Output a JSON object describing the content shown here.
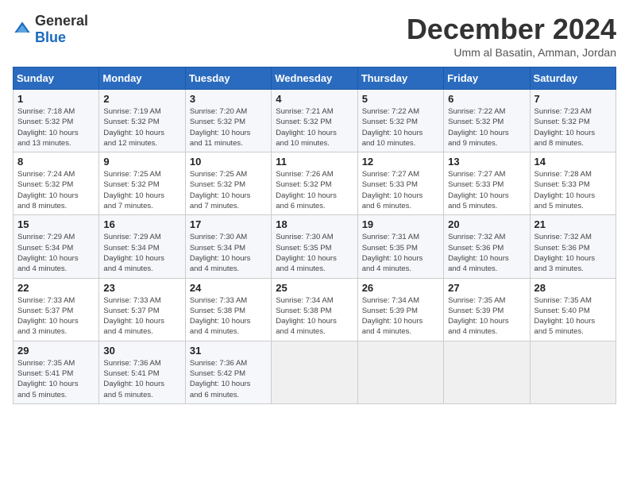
{
  "logo": {
    "general": "General",
    "blue": "Blue"
  },
  "header": {
    "month_year": "December 2024",
    "location": "Umm al Basatin, Amman, Jordan"
  },
  "weekdays": [
    "Sunday",
    "Monday",
    "Tuesday",
    "Wednesday",
    "Thursday",
    "Friday",
    "Saturday"
  ],
  "weeks": [
    [
      {
        "day": "1",
        "info": "Sunrise: 7:18 AM\nSunset: 5:32 PM\nDaylight: 10 hours\nand 13 minutes."
      },
      {
        "day": "2",
        "info": "Sunrise: 7:19 AM\nSunset: 5:32 PM\nDaylight: 10 hours\nand 12 minutes."
      },
      {
        "day": "3",
        "info": "Sunrise: 7:20 AM\nSunset: 5:32 PM\nDaylight: 10 hours\nand 11 minutes."
      },
      {
        "day": "4",
        "info": "Sunrise: 7:21 AM\nSunset: 5:32 PM\nDaylight: 10 hours\nand 10 minutes."
      },
      {
        "day": "5",
        "info": "Sunrise: 7:22 AM\nSunset: 5:32 PM\nDaylight: 10 hours\nand 10 minutes."
      },
      {
        "day": "6",
        "info": "Sunrise: 7:22 AM\nSunset: 5:32 PM\nDaylight: 10 hours\nand 9 minutes."
      },
      {
        "day": "7",
        "info": "Sunrise: 7:23 AM\nSunset: 5:32 PM\nDaylight: 10 hours\nand 8 minutes."
      }
    ],
    [
      {
        "day": "8",
        "info": "Sunrise: 7:24 AM\nSunset: 5:32 PM\nDaylight: 10 hours\nand 8 minutes."
      },
      {
        "day": "9",
        "info": "Sunrise: 7:25 AM\nSunset: 5:32 PM\nDaylight: 10 hours\nand 7 minutes."
      },
      {
        "day": "10",
        "info": "Sunrise: 7:25 AM\nSunset: 5:32 PM\nDaylight: 10 hours\nand 7 minutes."
      },
      {
        "day": "11",
        "info": "Sunrise: 7:26 AM\nSunset: 5:32 PM\nDaylight: 10 hours\nand 6 minutes."
      },
      {
        "day": "12",
        "info": "Sunrise: 7:27 AM\nSunset: 5:33 PM\nDaylight: 10 hours\nand 6 minutes."
      },
      {
        "day": "13",
        "info": "Sunrise: 7:27 AM\nSunset: 5:33 PM\nDaylight: 10 hours\nand 5 minutes."
      },
      {
        "day": "14",
        "info": "Sunrise: 7:28 AM\nSunset: 5:33 PM\nDaylight: 10 hours\nand 5 minutes."
      }
    ],
    [
      {
        "day": "15",
        "info": "Sunrise: 7:29 AM\nSunset: 5:34 PM\nDaylight: 10 hours\nand 4 minutes."
      },
      {
        "day": "16",
        "info": "Sunrise: 7:29 AM\nSunset: 5:34 PM\nDaylight: 10 hours\nand 4 minutes."
      },
      {
        "day": "17",
        "info": "Sunrise: 7:30 AM\nSunset: 5:34 PM\nDaylight: 10 hours\nand 4 minutes."
      },
      {
        "day": "18",
        "info": "Sunrise: 7:30 AM\nSunset: 5:35 PM\nDaylight: 10 hours\nand 4 minutes."
      },
      {
        "day": "19",
        "info": "Sunrise: 7:31 AM\nSunset: 5:35 PM\nDaylight: 10 hours\nand 4 minutes."
      },
      {
        "day": "20",
        "info": "Sunrise: 7:32 AM\nSunset: 5:36 PM\nDaylight: 10 hours\nand 4 minutes."
      },
      {
        "day": "21",
        "info": "Sunrise: 7:32 AM\nSunset: 5:36 PM\nDaylight: 10 hours\nand 3 minutes."
      }
    ],
    [
      {
        "day": "22",
        "info": "Sunrise: 7:33 AM\nSunset: 5:37 PM\nDaylight: 10 hours\nand 3 minutes."
      },
      {
        "day": "23",
        "info": "Sunrise: 7:33 AM\nSunset: 5:37 PM\nDaylight: 10 hours\nand 4 minutes."
      },
      {
        "day": "24",
        "info": "Sunrise: 7:33 AM\nSunset: 5:38 PM\nDaylight: 10 hours\nand 4 minutes."
      },
      {
        "day": "25",
        "info": "Sunrise: 7:34 AM\nSunset: 5:38 PM\nDaylight: 10 hours\nand 4 minutes."
      },
      {
        "day": "26",
        "info": "Sunrise: 7:34 AM\nSunset: 5:39 PM\nDaylight: 10 hours\nand 4 minutes."
      },
      {
        "day": "27",
        "info": "Sunrise: 7:35 AM\nSunset: 5:39 PM\nDaylight: 10 hours\nand 4 minutes."
      },
      {
        "day": "28",
        "info": "Sunrise: 7:35 AM\nSunset: 5:40 PM\nDaylight: 10 hours\nand 5 minutes."
      }
    ],
    [
      {
        "day": "29",
        "info": "Sunrise: 7:35 AM\nSunset: 5:41 PM\nDaylight: 10 hours\nand 5 minutes."
      },
      {
        "day": "30",
        "info": "Sunrise: 7:36 AM\nSunset: 5:41 PM\nDaylight: 10 hours\nand 5 minutes."
      },
      {
        "day": "31",
        "info": "Sunrise: 7:36 AM\nSunset: 5:42 PM\nDaylight: 10 hours\nand 6 minutes."
      },
      {
        "day": "",
        "info": ""
      },
      {
        "day": "",
        "info": ""
      },
      {
        "day": "",
        "info": ""
      },
      {
        "day": "",
        "info": ""
      }
    ]
  ]
}
